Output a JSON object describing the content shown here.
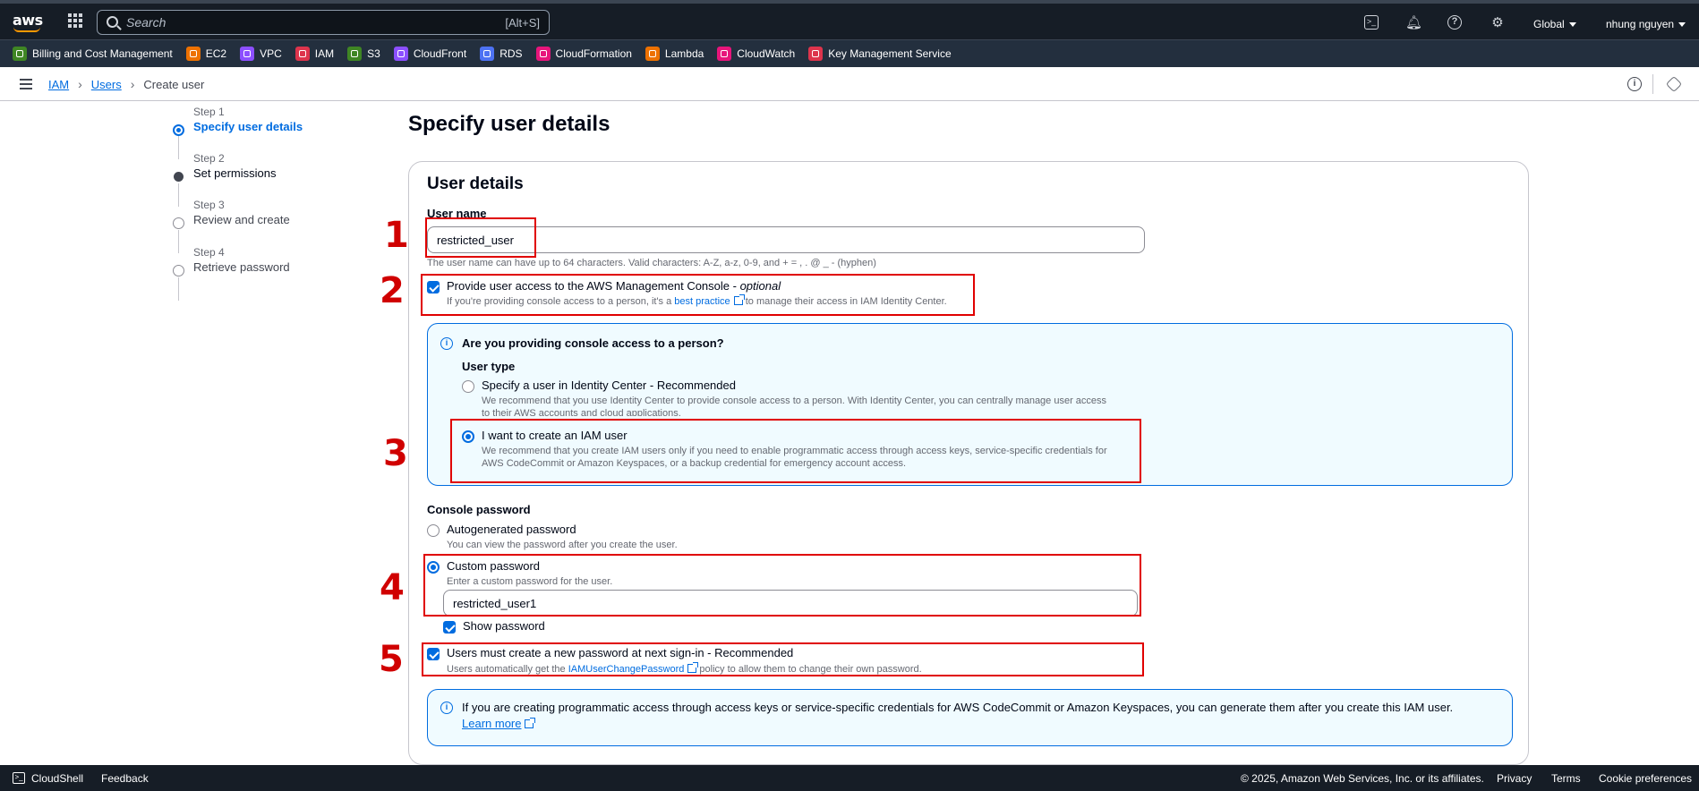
{
  "topnav": {
    "search_placeholder": "Search",
    "search_shortcut": "[Alt+S]",
    "region": "Global",
    "user": "nhung nguyen",
    "icons": [
      "cloudshell-icon",
      "bell-icon",
      "help-icon",
      "gear-icon"
    ]
  },
  "favorites": [
    {
      "label": "Billing and Cost Management",
      "color": "#3f8624"
    },
    {
      "label": "EC2",
      "color": "#ed7100"
    },
    {
      "label": "VPC",
      "color": "#8c4fff"
    },
    {
      "label": "IAM",
      "color": "#dd344c"
    },
    {
      "label": "S3",
      "color": "#3f8624"
    },
    {
      "label": "CloudFront",
      "color": "#8c4fff"
    },
    {
      "label": "RDS",
      "color": "#4d72f3"
    },
    {
      "label": "CloudFormation",
      "color": "#e7157b"
    },
    {
      "label": "Lambda",
      "color": "#ed7100"
    },
    {
      "label": "CloudWatch",
      "color": "#e7157b"
    },
    {
      "label": "Key Management Service",
      "color": "#dd344c"
    }
  ],
  "breadcrumb": {
    "iam": "IAM",
    "users": "Users",
    "current": "Create user"
  },
  "steps": [
    {
      "num": "Step 1",
      "name": "Specify user details"
    },
    {
      "num": "Step 2",
      "name": "Set permissions"
    },
    {
      "num": "Step 3",
      "name": "Review and create"
    },
    {
      "num": "Step 4",
      "name": "Retrieve password"
    }
  ],
  "page_title": "Specify user details",
  "user_details": {
    "heading": "User details",
    "username_label": "User name",
    "username_value": "restricted_user",
    "username_hint": "The user name can have up to 64 characters. Valid characters: A-Z, a-z, 0-9, and + = , . @ _ - (hyphen)",
    "console_access_label": "Provide user access to the AWS Management Console - ",
    "console_access_optional": "optional",
    "console_access_hint_pre": "If you're providing console access to a person, it's a ",
    "console_access_hint_link": "best practice",
    "console_access_hint_post": " to manage their access in IAM Identity Center."
  },
  "person_box": {
    "title": "Are you providing console access to a person?",
    "user_type_label": "User type",
    "option1_label": "Specify a user in Identity Center - Recommended",
    "option1_hint1": "We recommend that you use Identity Center to provide console access to a person. With Identity Center, you can centrally manage user access",
    "option1_hint2": "to their AWS accounts and cloud applications.",
    "option2_label": "I want to create an IAM user",
    "option2_hint1": "We recommend that you create IAM users only if you need to enable programmatic access through access keys, service-specific credentials for",
    "option2_hint2": "AWS CodeCommit or Amazon Keyspaces, or a backup credential for emergency account access."
  },
  "password": {
    "label": "Console password",
    "auto_label": "Autogenerated password",
    "auto_hint": "You can view the password after you create the user.",
    "custom_label": "Custom password",
    "custom_hint": "Enter a custom password for the user.",
    "custom_value": "restricted_user1",
    "show_label": "Show password",
    "reset_label": "Users must create a new password at next sign-in - Recommended",
    "reset_hint_pre": "Users automatically get the ",
    "reset_hint_link": "IAMUserChangePassword",
    "reset_hint_post": " policy to allow them to change their own password."
  },
  "bottom_info": {
    "text": "If you are creating programmatic access through access keys or service-specific credentials for AWS CodeCommit or Amazon Keyspaces, you can generate them after you create this IAM user.",
    "link": "Learn more"
  },
  "annotations": [
    "1",
    "2",
    "3",
    "4",
    "5"
  ],
  "footer": {
    "cloudshell": "CloudShell",
    "feedback": "Feedback",
    "copyright": "© 2025, Amazon Web Services, Inc. or its affiliates.",
    "privacy": "Privacy",
    "terms": "Terms",
    "cookies": "Cookie preferences"
  }
}
